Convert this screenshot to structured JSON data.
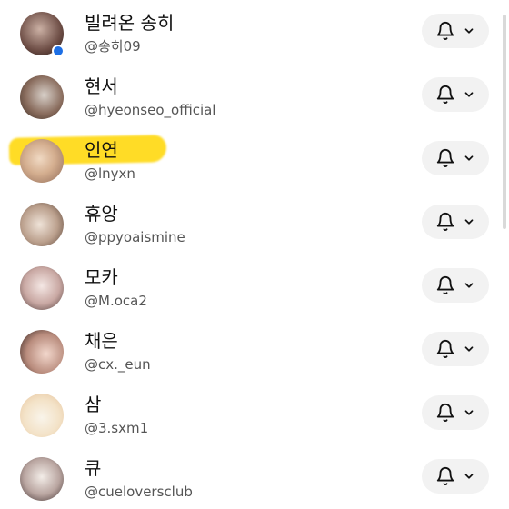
{
  "rows": [
    {
      "name": "빌려온 송히",
      "handle": "@송히09",
      "avatar": "avatar"
    },
    {
      "name": "현서",
      "handle": "@hyeonseo_official",
      "avatar": "avatar"
    },
    {
      "name": "인연",
      "handle": "@lnyxn",
      "avatar": "avatar"
    },
    {
      "name": "휴앙",
      "handle": "@ppyoaismine",
      "avatar": "avatar"
    },
    {
      "name": "모카",
      "handle": "@M.oca2",
      "avatar": "avatar"
    },
    {
      "name": "채은",
      "handle": "@cx._eun",
      "avatar": "avatar"
    },
    {
      "name": "삼",
      "handle": "@3.sxm1",
      "avatar": "avatar"
    },
    {
      "name": "큐",
      "handle": "@cueloversclub",
      "avatar": "avatar"
    }
  ],
  "icons": {
    "bell": "bell-icon",
    "chevron": "chevron-down-icon"
  },
  "colors": {
    "presence_dot": "#1d6fe5",
    "highlight": "#ffd600",
    "button_bg": "#f2f2f2"
  }
}
